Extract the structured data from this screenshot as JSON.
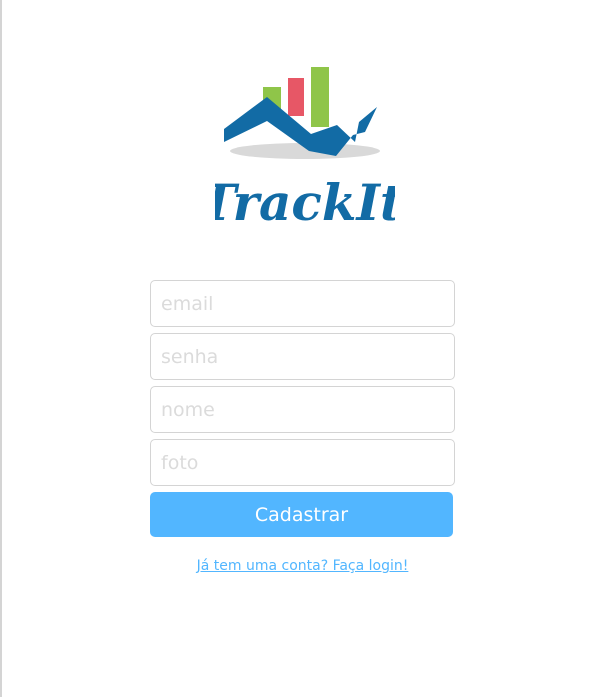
{
  "brand": {
    "logo_text": "TrackIt",
    "colors": {
      "bar_green": "#8fc549",
      "bar_red": "#e75766",
      "arrow_blue": "#126ba5",
      "shadow_gray": "#d9d9d9",
      "accent": "#52b6ff"
    }
  },
  "form": {
    "email_placeholder": "email",
    "password_placeholder": "senha",
    "name_placeholder": "nome",
    "photo_placeholder": "foto",
    "submit_label": "Cadastrar"
  },
  "login_link": "Já tem uma conta? Faça login!"
}
